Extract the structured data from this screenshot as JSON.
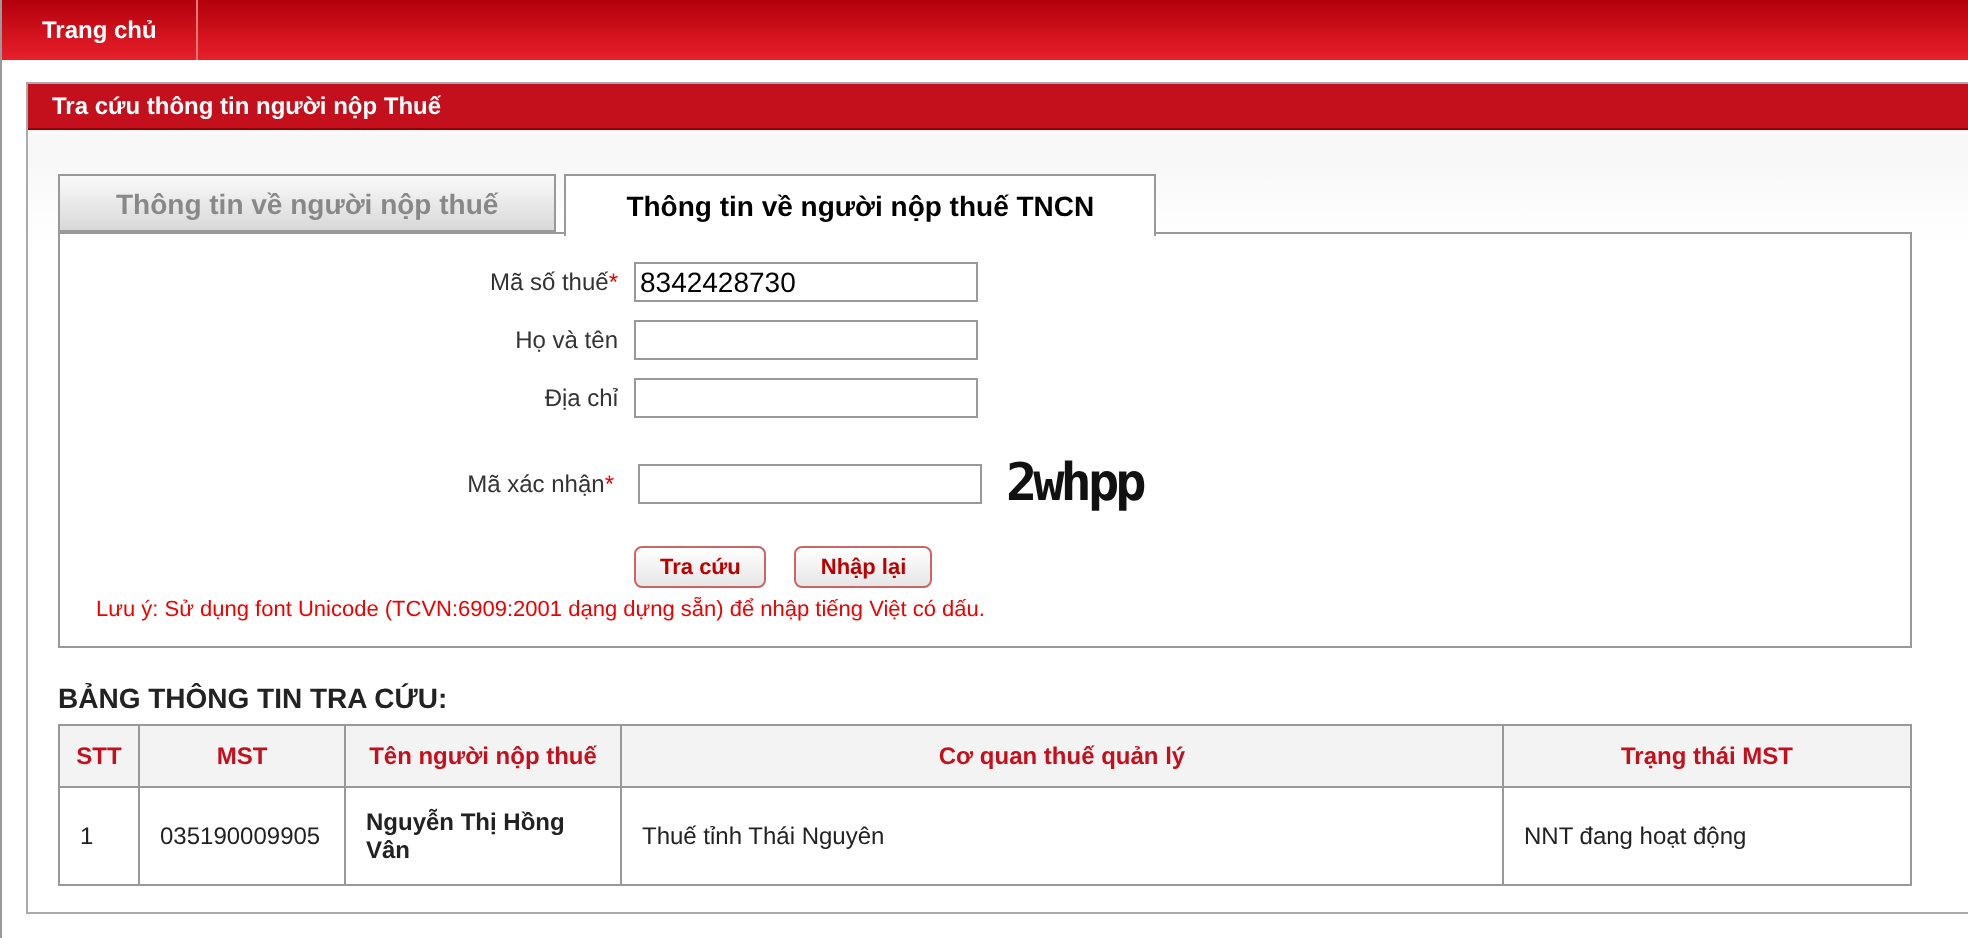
{
  "nav": {
    "items": [
      {
        "label": "Trang chủ",
        "selected": true
      }
    ]
  },
  "panel": {
    "title": "Tra cứu thông tin người nộp Thuế"
  },
  "tabs": [
    {
      "label": "Thông tin về người nộp thuế",
      "selected": false
    },
    {
      "label": "Thông tin về người nộp thuế TNCN",
      "selected": true
    }
  ],
  "form": {
    "fields": [
      {
        "label": "Mã số thuế",
        "required_mark": "*",
        "value": "8342428730"
      },
      {
        "label": "Họ và tên"
      },
      {
        "label": "Địa chỉ"
      }
    ],
    "captcha": {
      "label": "Mã xác nhận",
      "required_mark": "*",
      "code": "2whpp"
    },
    "buttons": [
      "Tra cứu",
      "Nhập lại"
    ],
    "note": "Lưu ý: Sử dụng font Unicode (TCVN:6909:2001 dạng dựng sẵn) để nhập tiếng Việt có dấu."
  },
  "results": {
    "title": "BẢNG THÔNG TIN TRA CỨU:",
    "columns": [
      "STT",
      "MST",
      "Tên người nộp thuế",
      "Cơ quan thuế quản lý",
      "Trạng thái MST"
    ],
    "rows": [
      [
        "1",
        "035190009905",
        "Nguyễn Thị Hồng Vân",
        "Thuế tỉnh Thái Nguyên",
        "NNT đang hoạt động"
      ]
    ]
  }
}
